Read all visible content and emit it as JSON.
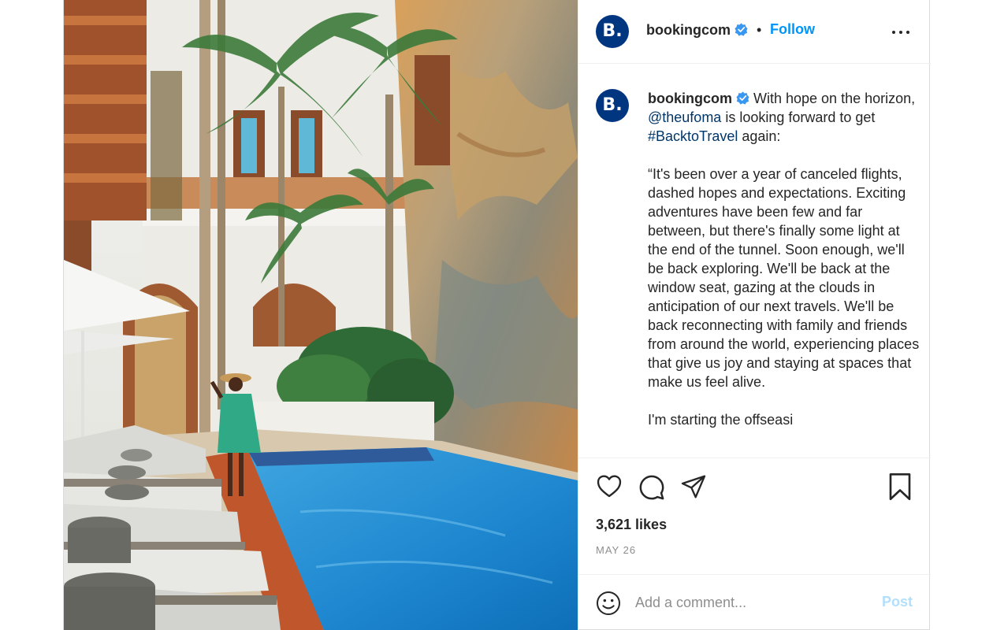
{
  "post": {
    "username": "bookingcom",
    "avatar_text": "B.",
    "brand_color": "#003580",
    "follow_label": "Follow",
    "dot": "•",
    "accent_color": "#0095f6",
    "photo": {
      "scene": "poolside courtyard with palm trees, stone wall, lounge chairs and a woman in a green dress"
    }
  },
  "caption": {
    "username": "bookingcom",
    "intro_before": " With hope on the horizon, ",
    "mention": "@theufoma",
    "intro_middle": " is looking forward to get ",
    "hashtag": "#BacktoTravel",
    "intro_after": " again:",
    "quote": "“It's been over a year of canceled flights, dashed hopes and expectations. Exciting adventures have been few and far between, but there's finally some light at the end of the tunnel. Soon enough, we'll be back exploring. We'll be back at the window seat, gazing at the clouds in anticipation of our next travels. We'll be back reconnecting with family and friends from around the world, experiencing places that give us joy and staying at spaces that make us feel alive.",
    "truncated": "I'm starting the offseasi"
  },
  "stats": {
    "likes": "3,621 likes",
    "date": "MAY 26"
  },
  "comment": {
    "placeholder": "Add a comment...",
    "post_label": "Post"
  },
  "icons": {
    "like": "heart-icon",
    "comment": "comment-icon",
    "share": "share-icon",
    "save": "bookmark-icon",
    "more": "more-options-icon",
    "emoji": "emoji-icon",
    "verified": "verified-badge-icon"
  }
}
